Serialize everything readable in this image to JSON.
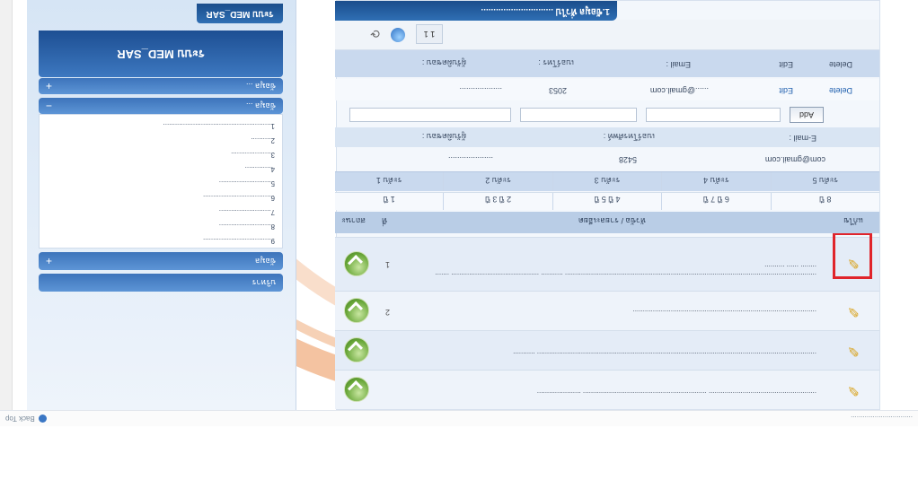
{
  "titlebar": {
    "left_text": "...............................",
    "right_text": "Back Top"
  },
  "rows": [
    {
      "num": "",
      "text": "...................................................... .............................................................. ......................"
    },
    {
      "num": "",
      "text": "............................................................................................................................................ ..........."
    },
    {
      "num": "2",
      "text": "............................................................................................"
    },
    {
      "num": "1",
      "text": ".............................................................................................................................. ........... ............................................ ....... ........ ...... .........."
    }
  ],
  "table_header": {
    "col_action": "แก้ไข",
    "col_title": "หัวข้อ / รายละเอียด",
    "col_no": "ที่",
    "col_status": "สถานะ"
  },
  "grid_top": [
    "ระดับ 5",
    "ระดับ 4",
    "ระดับ 3",
    "ระดับ 2",
    "ระดับ 1"
  ],
  "grid_bottom": [
    "8 ปี",
    "6 ปี 7 ปี",
    "4 ปี 5 ปี",
    "2 ปี 3 ปี",
    "1 ปี"
  ],
  "contact_label": {
    "email": "E-mail :",
    "phone": "เบอร์โทรศัพท์ :",
    "owner": "ผู้รับผิดชอบ :"
  },
  "contact_values": {
    "email": "com@gmail.com",
    "phone": "5428",
    "name": "...................."
  },
  "add_button": "Add",
  "person_row": {
    "delete": "Delete",
    "edit": "Edit",
    "email_label": "Email :",
    "phone_label": "เบอร์โทร :",
    "owner_label": "ผู้รับผิดชอบ :"
  },
  "person_values": {
    "delete": "Delete",
    "edit": "Edit",
    "email": "......@gmail.com",
    "phone": "2053",
    "name": "..................."
  },
  "pager": {
    "page": "1 1"
  },
  "main_title": "1.ข้อมูล ทั่วไป .............................",
  "sidebar": {
    "section_bottom": "บริหาร",
    "section_plus": "ข้อมูล",
    "list_items": [
      "9..................................",
      "8..........................",
      "7..........................",
      "6..................................",
      "5..........................",
      "4.............",
      "3....................",
      "2..........",
      "1......................................................"
    ],
    "section_mid": "ข้อมูล ...",
    "section_top": "ข้อมูล ...",
    "brand": "ระบบ MED_SAR",
    "foot": "ระบบ MED_SAR"
  },
  "colors": {
    "accent": "#2f6fb4",
    "header_bg": "#b9cde6",
    "highlight": "#e0242b",
    "check_icon": "#6aa83a"
  }
}
